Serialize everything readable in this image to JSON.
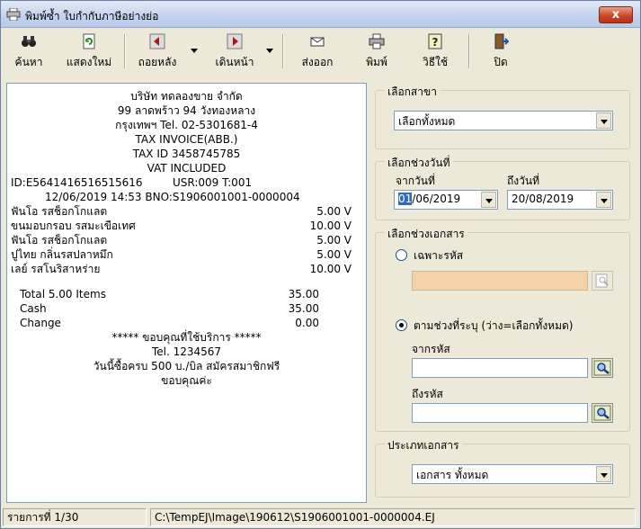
{
  "window": {
    "title": "พิมพ์ซ้ำ ใบกำกับภาษีอย่างย่อ",
    "close_label": "x"
  },
  "toolbar": {
    "find": "ค้นหา",
    "show_all": "แสดงใหม่",
    "back": "ถอยหลัง",
    "forward": "เดินหน้า",
    "export": "ส่งออก",
    "print": "พิมพ์",
    "howto": "วิธีใช้",
    "close": "ปิด"
  },
  "receipt": {
    "header": [
      "บริษัท ทดลองขาย จำกัด",
      "99 ลาดพร้าว 94 วังทองหลาง",
      "กรุงเทพฯ Tel. 02-5301681-4",
      "TAX INVOICE(ABB.)",
      "TAX ID 3458745785",
      "VAT INCLUDED"
    ],
    "id_line": "ID:E5641416516515616",
    "usr_line": "USR:009 T:001",
    "date_line": "12/06/2019 14:53 BNO:S1906001001-0000004",
    "items": [
      {
        "name": "ฟันโอ รสช็อกโกแลต",
        "amount": "5.00 V"
      },
      {
        "name": "ขนมอบกรอบ รสมะเขือเทศ",
        "amount": "10.00 V"
      },
      {
        "name": "ฟันโอ รสช็อกโกแลต",
        "amount": "5.00 V"
      },
      {
        "name": "ปูไทย กลิ่นรสปลาหมึก",
        "amount": "5.00 V"
      },
      {
        "name": "เลย์ รสโนริสาหร่าย",
        "amount": "10.00 V"
      }
    ],
    "totals": [
      {
        "label": "Total 5.00 Items",
        "value": "35.00"
      },
      {
        "label": "Cash",
        "value": "35.00"
      },
      {
        "label": "Change",
        "value": "0.00"
      }
    ],
    "footer": [
      "***** ขอบคุณที่ใช้บริการ *****",
      "Tel. 1234567",
      "วันนี้ซื้อครบ 500 บ./บิล สมัครสมาชิกฟรี",
      "ขอบคุณค่ะ"
    ]
  },
  "branch": {
    "title": "เลือกสาขา",
    "value": "เลือกทั้งหมด"
  },
  "date_range": {
    "title": "เลือกช่วงวันที่",
    "from_label": "จากวันที่",
    "from_day": "01",
    "from_rest": "/06/2019",
    "to_label": "ถึงวันที่",
    "to_value": "20/08/2019"
  },
  "doc_range": {
    "title": "เลือกช่วงเอกสาร",
    "specific_label": "เฉพาะรหัส",
    "range_label": "ตามช่วงที่ระบุ (ว่าง=เลือกทั้งหมด)",
    "from_code_label": "จากรหัส",
    "to_code_label": "ถึงรหัส"
  },
  "doc_type": {
    "title": "ประเภทเอกสาร",
    "value": "เอกสาร ทั้งหมด"
  },
  "status": {
    "record": "รายการที่ 1/30",
    "path": "C:\\TempEJ\\Image\\190612\\S1906001001-0000004.EJ"
  },
  "colors": {
    "accent": "#316ac5",
    "disabled_field": "#f5d1a8"
  }
}
